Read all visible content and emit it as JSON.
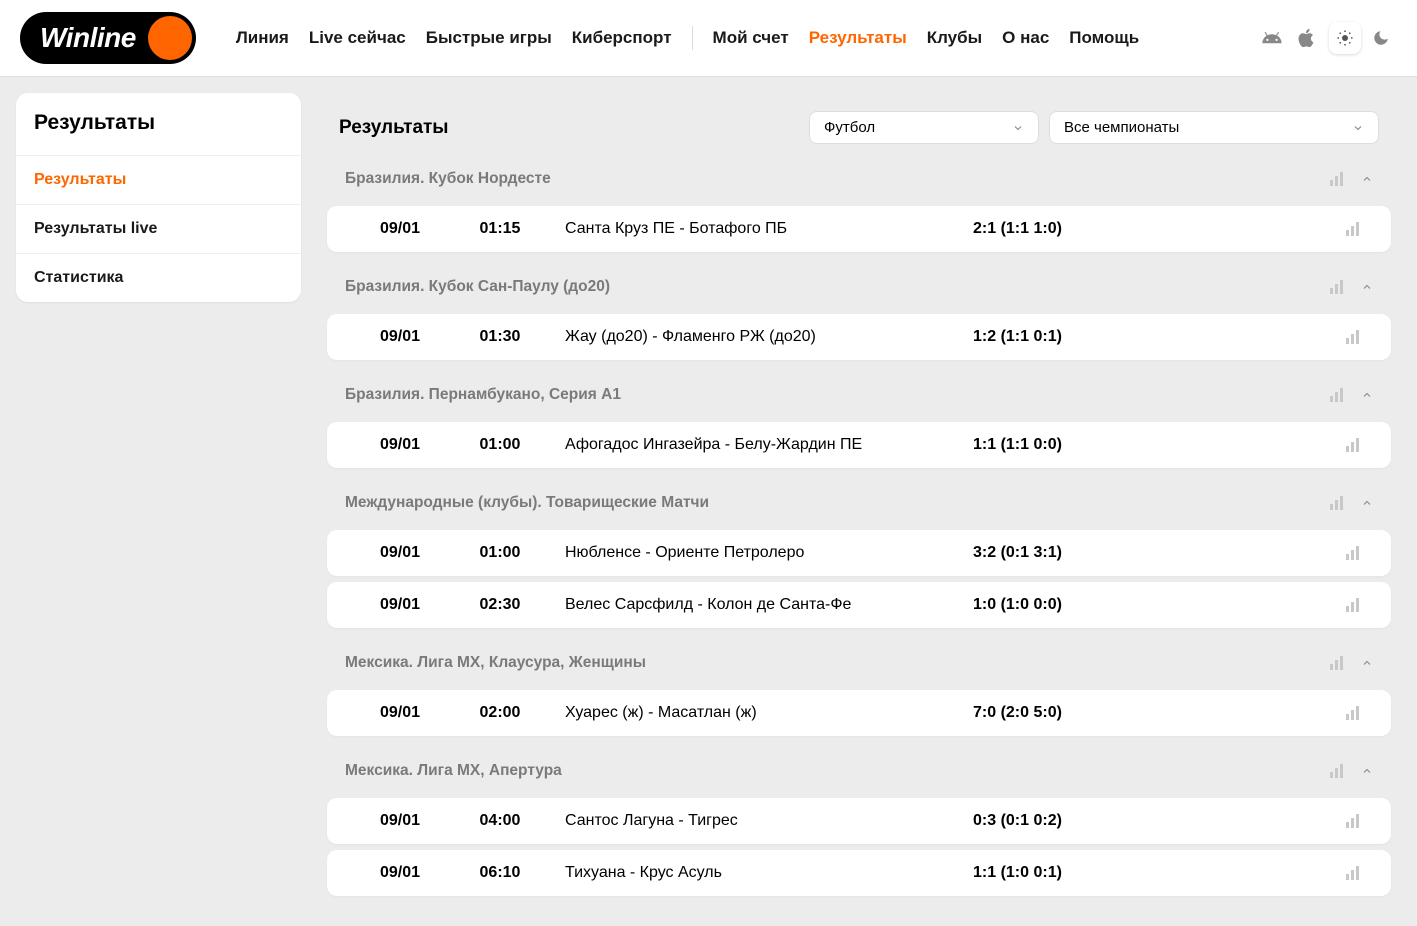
{
  "logo": {
    "text": "Winline"
  },
  "nav": {
    "items": [
      "Линия",
      "Live сейчас",
      "Быстрые игры",
      "Киберспорт",
      "Мой счет",
      "Результаты",
      "Клубы",
      "О нас",
      "Помощь"
    ],
    "activeIndex": 5
  },
  "sidebar": {
    "title": "Результаты",
    "items": [
      "Результаты",
      "Результаты live",
      "Статистика"
    ],
    "activeIndex": 0
  },
  "main": {
    "title": "Результаты",
    "sportSelect": "Футбол",
    "championshipSelect": "Все чемпионаты"
  },
  "leagues": [
    {
      "name": "Бразилия. Кубок Нордесте",
      "matches": [
        {
          "date": "09/01",
          "time": "01:15",
          "teams": "Санта Круз ПЕ - Ботафого ПБ",
          "score": "2:1 (1:1 1:0)"
        }
      ]
    },
    {
      "name": "Бразилия. Кубок Сан-Паулу (до20)",
      "matches": [
        {
          "date": "09/01",
          "time": "01:30",
          "teams": "Жау (до20) - Фламенго РЖ (до20)",
          "score": "1:2 (1:1 0:1)"
        }
      ]
    },
    {
      "name": "Бразилия. Пернамбукано, Серия А1",
      "matches": [
        {
          "date": "09/01",
          "time": "01:00",
          "teams": "Афогадос Ингазейра - Белу-Жардин ПЕ",
          "score": "1:1 (1:1 0:0)"
        }
      ]
    },
    {
      "name": "Международные (клубы). Товарищеские Матчи",
      "matches": [
        {
          "date": "09/01",
          "time": "01:00",
          "teams": "Нюбленсе - Ориенте Петролеро",
          "score": "3:2 (0:1 3:1)"
        },
        {
          "date": "09/01",
          "time": "02:30",
          "teams": "Велес Сарсфилд - Колон де Санта-Фе",
          "score": "1:0 (1:0 0:0)"
        }
      ]
    },
    {
      "name": "Мексика. Лига МХ, Клаусура, Женщины",
      "matches": [
        {
          "date": "09/01",
          "time": "02:00",
          "teams": "Хуарес (ж) - Масатлан (ж)",
          "score": "7:0 (2:0 5:0)"
        }
      ]
    },
    {
      "name": "Мексика. Лига МХ, Апертура",
      "matches": [
        {
          "date": "09/01",
          "time": "04:00",
          "teams": "Сантос Лагуна - Тигрес",
          "score": "0:3 (0:1 0:2)"
        },
        {
          "date": "09/01",
          "time": "06:10",
          "teams": "Тихуана - Крус Асуль",
          "score": "1:1 (1:0 0:1)"
        }
      ]
    }
  ]
}
